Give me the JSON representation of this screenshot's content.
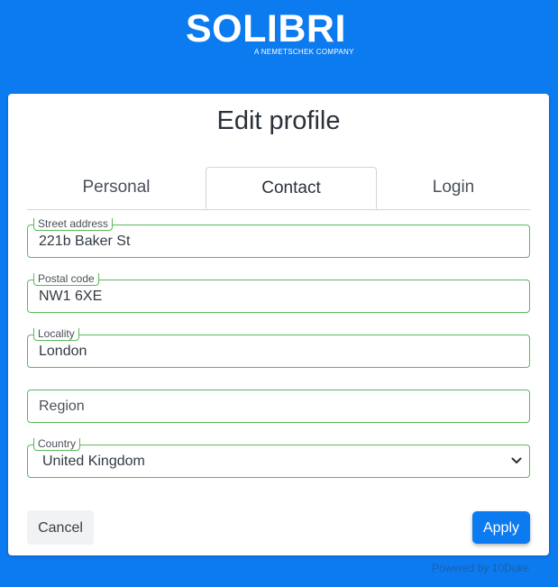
{
  "brand": {
    "name": "SOLIBRI",
    "tagline": "A NEMETSCHEK COMPANY"
  },
  "page": {
    "title": "Edit profile"
  },
  "tabs": [
    {
      "label": "Personal",
      "active": false
    },
    {
      "label": "Contact",
      "active": true
    },
    {
      "label": "Login",
      "active": false
    }
  ],
  "form": {
    "street": {
      "label": "Street address",
      "value": "221b Baker St"
    },
    "postal": {
      "label": "Postal code",
      "value": "NW1 6XE"
    },
    "locality": {
      "label": "Locality",
      "value": "London"
    },
    "region": {
      "placeholder": "Region",
      "value": ""
    },
    "country": {
      "label": "Country",
      "value": "United Kingdom"
    }
  },
  "actions": {
    "cancel_label": "Cancel",
    "apply_label": "Apply"
  },
  "footer": {
    "powered_by": "Powered by 10Duke"
  },
  "colors": {
    "background": "#0d7bf0",
    "field_border": "#5cb85c",
    "apply_button": "#0d7bf0"
  },
  "icons": {
    "select_arrow": "chevron-down-icon"
  }
}
